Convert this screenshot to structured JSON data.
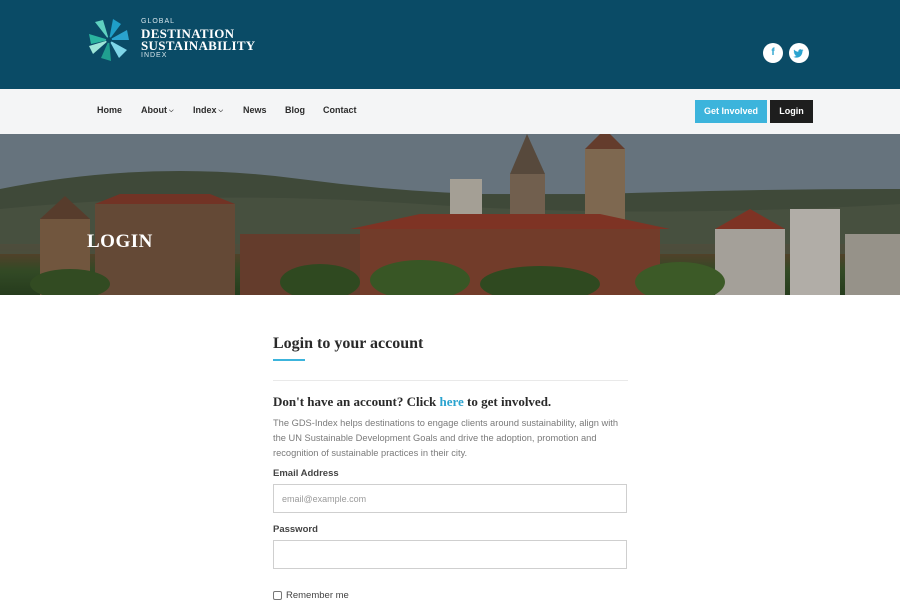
{
  "header": {
    "logo": {
      "line_small_top": "GLOBAL",
      "line1": "DESTINATION",
      "line2": "SUSTAINABILITY",
      "line_small_bottom": "INDEX"
    },
    "social": [
      {
        "label": "f",
        "icon": "facebook-icon"
      },
      {
        "label": "t",
        "icon": "twitter-icon"
      }
    ]
  },
  "nav": {
    "items": [
      {
        "label": "Home",
        "has_caret": false
      },
      {
        "label": "About",
        "has_caret": true
      },
      {
        "label": "Index",
        "has_caret": true
      },
      {
        "label": "News",
        "has_caret": false
      },
      {
        "label": "Blog",
        "has_caret": false
      },
      {
        "label": "Contact",
        "has_caret": false
      }
    ],
    "get_involved": "Get Involved",
    "login": "Login"
  },
  "hero": {
    "title": "LOGIN"
  },
  "form": {
    "heading": "Login to your account",
    "signup_prefix": "Don't have an account? Click ",
    "signup_link": "here",
    "signup_suffix": " to get involved.",
    "description": "The GDS-Index helps destinations to engage clients around sustainability, align with the UN Sustainable Development Goals and drive the adoption, promotion and recognition of sustainable practices in their city.",
    "email_label": "Email Address",
    "email_placeholder": "email@example.com",
    "email_value": "",
    "password_label": "Password",
    "password_value": "",
    "remember_label": "Remember me",
    "remember_checked": false
  },
  "colors": {
    "header_bg": "#0a4b66",
    "accent": "#3cb4dc",
    "dark_button": "#1e1e1e"
  }
}
